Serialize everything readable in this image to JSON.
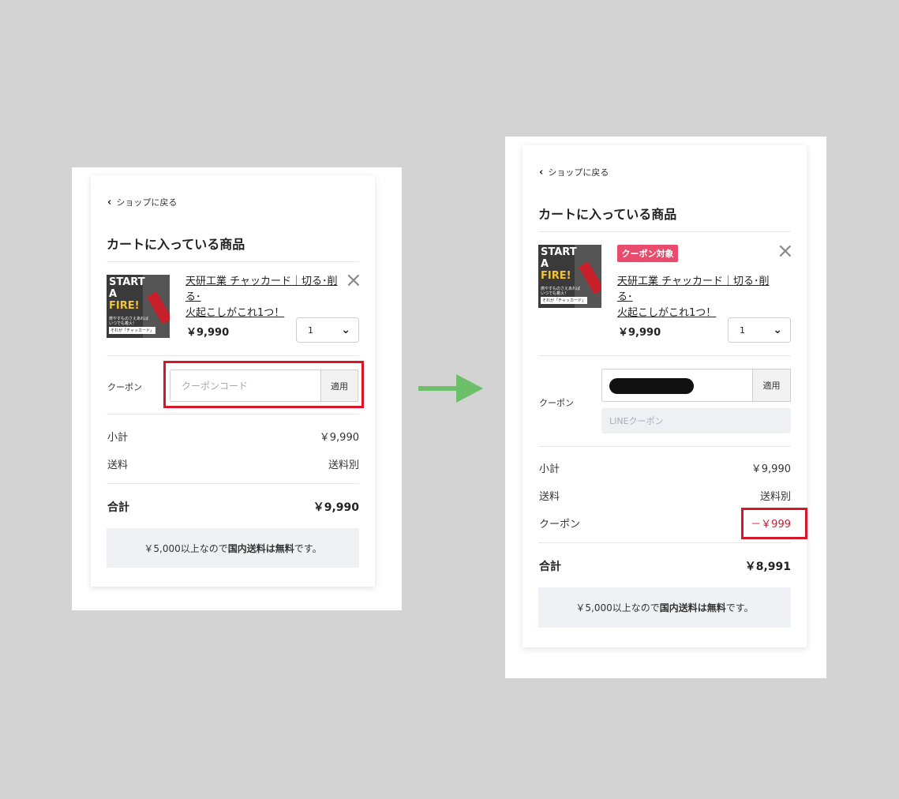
{
  "before": {
    "back_link": "ショップに戻る",
    "title": "カートに入っている商品",
    "product": {
      "name_line1": "天研工業 チャッカード｜切る･削る･",
      "name_line2": "火起こしがこれ1つ！",
      "price": "￥9,990",
      "qty": "1",
      "thumb_line1": "START",
      "thumb_line2": "A",
      "thumb_line3": "FIRE!",
      "thumb_caption1": "燃やすものさえあれば",
      "thumb_caption2": "いつでも着火！",
      "thumb_caption3": "それが「チャッカード」"
    },
    "coupon_label": "クーポン",
    "coupon_placeholder": "クーポンコード",
    "apply_label": "適用",
    "subtotal_label": "小計",
    "subtotal_value": "￥9,990",
    "shipping_label": "送料",
    "shipping_value": "送料別",
    "total_label": "合計",
    "total_value": "￥9,990",
    "note_prefix": "￥5,000以上なので",
    "note_bold1": "国内送料",
    "note_mid": "は",
    "note_bold2": "無料",
    "note_suffix": "です。"
  },
  "after": {
    "back_link": "ショップに戻る",
    "title": "カートに入っている商品",
    "badge": "クーポン対象",
    "product": {
      "name_line1": "天研工業 チャッカード｜切る･削る･",
      "name_line2": "火起こしがこれ1つ！",
      "price": "￥9,990",
      "qty": "1",
      "thumb_line1": "START",
      "thumb_line2": "A",
      "thumb_line3": "FIRE!",
      "thumb_caption1": "燃やすものさえあれば",
      "thumb_caption2": "いつでも着火！",
      "thumb_caption3": "それが「チャッカード」"
    },
    "coupon_label": "クーポン",
    "apply_label": "適用",
    "line_coupon_placeholder": "LINEクーポン",
    "subtotal_label": "小計",
    "subtotal_value": "￥9,990",
    "shipping_label": "送料",
    "shipping_value": "送料別",
    "discount_label": "クーポン",
    "discount_value": "－￥999",
    "total_label": "合計",
    "total_value": "￥8,991",
    "note_prefix": "￥5,000以上なので",
    "note_bold1": "国内送料",
    "note_mid": "は",
    "note_bold2": "無料",
    "note_suffix": "です。"
  },
  "colors": {
    "highlight": "#d6172a",
    "arrow": "#6cc06a",
    "badge": "#e94b6c",
    "discount": "#d6172a"
  },
  "icons": [
    "chevron-left-icon",
    "close-icon",
    "chevron-down-icon",
    "arrow-right-icon"
  ]
}
